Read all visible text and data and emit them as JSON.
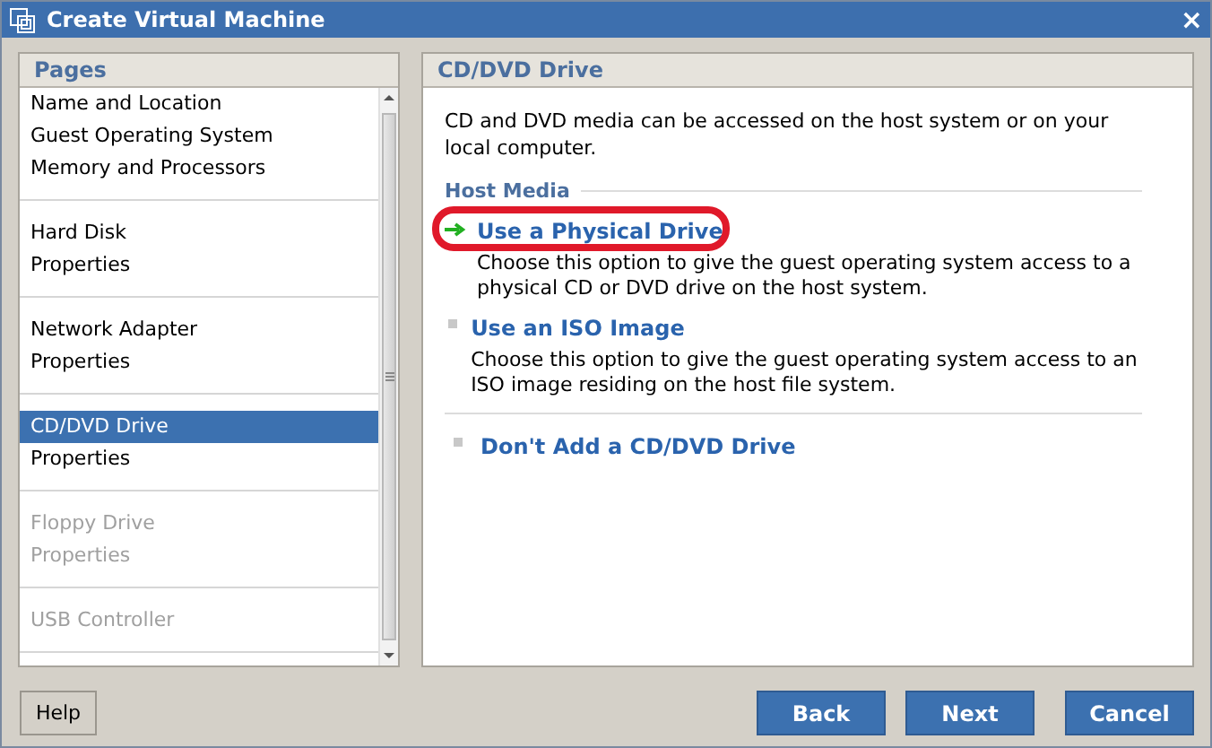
{
  "window": {
    "title": "Create Virtual Machine",
    "close": "×"
  },
  "pages": {
    "title": "Pages",
    "groups": [
      {
        "items": [
          {
            "label": "Name and Location",
            "selected": false,
            "disabled": false
          },
          {
            "label": "Guest Operating System",
            "selected": false,
            "disabled": false
          },
          {
            "label": "Memory and Processors",
            "selected": false,
            "disabled": false
          }
        ]
      },
      {
        "items": [
          {
            "label": "Hard Disk",
            "selected": false,
            "disabled": false
          },
          {
            "label": "Properties",
            "selected": false,
            "disabled": false
          }
        ]
      },
      {
        "items": [
          {
            "label": "Network Adapter",
            "selected": false,
            "disabled": false
          },
          {
            "label": "Properties",
            "selected": false,
            "disabled": false
          }
        ]
      },
      {
        "items": [
          {
            "label": "CD/DVD Drive",
            "selected": true,
            "disabled": false
          },
          {
            "label": "Properties",
            "selected": false,
            "disabled": false
          }
        ]
      },
      {
        "items": [
          {
            "label": "Floppy Drive",
            "selected": false,
            "disabled": true
          },
          {
            "label": "Properties",
            "selected": false,
            "disabled": true
          }
        ]
      },
      {
        "items": [
          {
            "label": "USB Controller",
            "selected": false,
            "disabled": true
          }
        ]
      }
    ]
  },
  "content": {
    "title": "CD/DVD Drive",
    "intro": "CD and DVD media can be accessed on the host system or on your local computer.",
    "section": "Host Media",
    "options": [
      {
        "label": "Use a Physical Drive",
        "description": "Choose this option to give the guest operating system access to a physical CD or DVD drive on the host system.",
        "selected": true,
        "highlighted": true
      },
      {
        "label": "Use an ISO Image",
        "description": "Choose this option to give the guest operating system access to an ISO image residing on the host file system.",
        "selected": false,
        "highlighted": false
      }
    ],
    "extra_options": [
      {
        "label": "Don't Add a CD/DVD Drive",
        "selected": false,
        "highlighted": false
      }
    ]
  },
  "buttons": {
    "help": "Help",
    "actions": [
      "Back",
      "Next",
      "Cancel"
    ]
  }
}
